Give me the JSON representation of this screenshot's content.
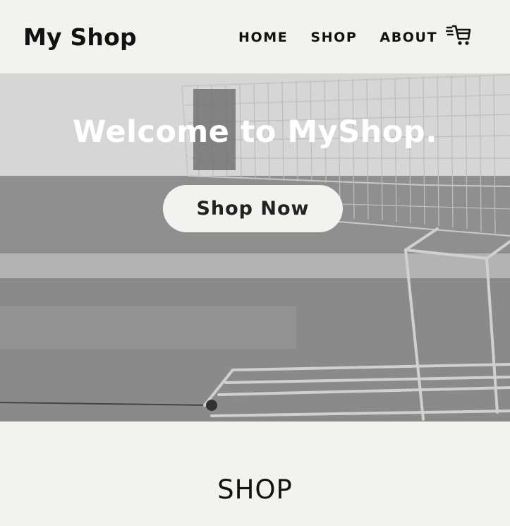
{
  "header": {
    "logo": "My Shop",
    "nav": [
      {
        "label": "HOME"
      },
      {
        "label": "SHOP"
      },
      {
        "label": "ABOUT"
      }
    ],
    "cart_icon": "shopping-cart-icon"
  },
  "hero": {
    "title": "Welcome to MyShop.",
    "cta_label": "Shop Now",
    "image": "shopping-cart-photo"
  },
  "shop_section": {
    "title": "SHOP"
  },
  "colors": {
    "background": "#f2f3ef",
    "text": "#111111",
    "hero_text": "#ffffff"
  }
}
